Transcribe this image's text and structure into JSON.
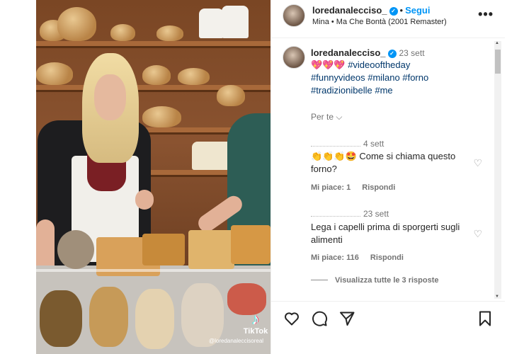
{
  "post": {
    "username": "loredanalecciso_",
    "follow_label": "Segui",
    "song": "Mina • Ma Che Bontà (2001 Remaster)",
    "more_label": "•••"
  },
  "caption": {
    "username": "loredanalecciso_",
    "time": "23 sett",
    "hearts": "💖💖💖",
    "line1_tag": "#videooftheday",
    "line2": "#funnyvideos #milano #forno",
    "line3": "#tradizionibelle #me",
    "for_you_label": "Per te"
  },
  "comments": [
    {
      "time": "4 sett",
      "text": "👏👏👏🤩 Come si chiama questo forno?",
      "likes": "Mi piace: 1",
      "reply_label": "Rispondi"
    },
    {
      "time": "23 sett",
      "text": "Lega i capelli prima di sporgerti sugli alimenti",
      "likes": "Mi piace: 116",
      "reply_label": "Rispondi"
    }
  ],
  "view_replies": "Visualizza tutte le 3 risposte",
  "media": {
    "watermark_brand": "TikTok",
    "watermark_user": "@loredanaleccisoreal"
  },
  "colors": {
    "accent": "#0095f6",
    "heart": "#ed4956",
    "hashtag": "#00376b"
  },
  "icons": [
    "verified-icon",
    "heart-icon",
    "comment-icon",
    "share-icon",
    "bookmark-icon",
    "chevron-down-icon",
    "tiktok-icon"
  ]
}
